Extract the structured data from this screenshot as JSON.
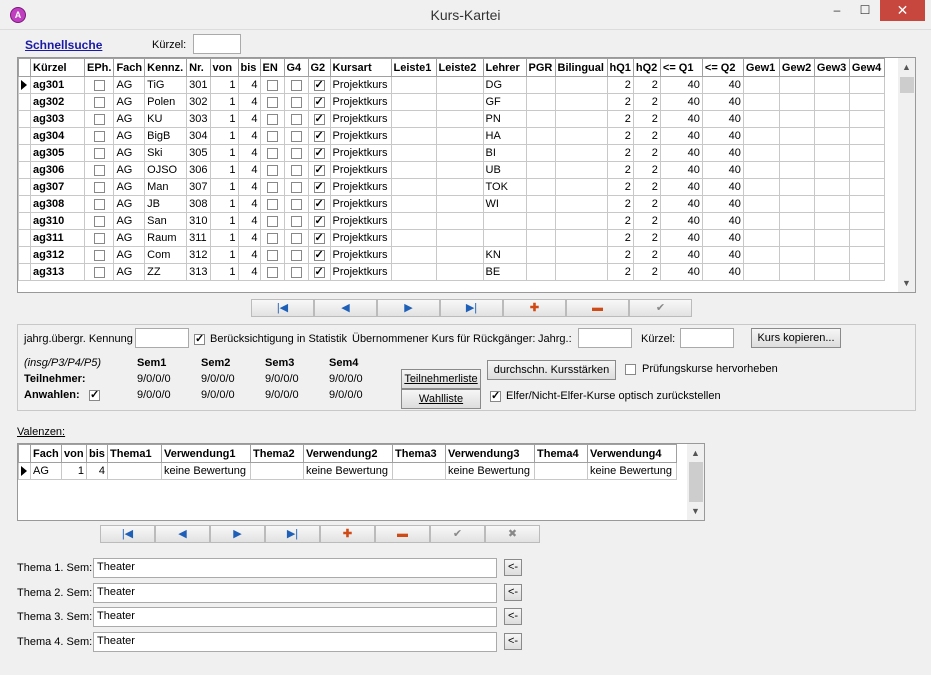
{
  "window": {
    "title": "Kurs-Kartei",
    "icon": "A",
    "min": "–",
    "max": "☐",
    "close": "✕"
  },
  "search": {
    "link": "Schnellsuche",
    "kuerzel_label": "Kürzel:",
    "kuerzel_value": ""
  },
  "main_grid": {
    "columns": [
      "Kürzel",
      "EPh.",
      "Fach",
      "Kennz.",
      "Nr.",
      "von",
      "bis",
      "EN",
      "G4",
      "G2",
      "Kursart",
      "Leiste1",
      "Leiste2",
      "Lehrer",
      "PGR",
      "Bilingual",
      "hQ1",
      "hQ2",
      "<= Q1",
      "<= Q2",
      "Gew1",
      "Gew2",
      "Gew3",
      "Gew4"
    ],
    "rows": [
      {
        "kuerzel": "ag301",
        "fach": "AG",
        "kennz": "TiG",
        "nr": "301",
        "von": "1",
        "bis": "4",
        "g2": true,
        "kursart": "Projektkurs",
        "lehrer": "DG",
        "hq1": "2",
        "hq2": "2",
        "q1": "40",
        "q2": "40"
      },
      {
        "kuerzel": "ag302",
        "fach": "AG",
        "kennz": "Polen",
        "nr": "302",
        "von": "1",
        "bis": "4",
        "g2": true,
        "kursart": "Projektkurs",
        "lehrer": "GF",
        "hq1": "2",
        "hq2": "2",
        "q1": "40",
        "q2": "40"
      },
      {
        "kuerzel": "ag303",
        "fach": "AG",
        "kennz": "KU",
        "nr": "303",
        "von": "1",
        "bis": "4",
        "g2": true,
        "kursart": "Projektkurs",
        "lehrer": "PN",
        "hq1": "2",
        "hq2": "2",
        "q1": "40",
        "q2": "40"
      },
      {
        "kuerzel": "ag304",
        "fach": "AG",
        "kennz": "BigB",
        "nr": "304",
        "von": "1",
        "bis": "4",
        "g2": true,
        "kursart": "Projektkurs",
        "lehrer": "HA",
        "hq1": "2",
        "hq2": "2",
        "q1": "40",
        "q2": "40"
      },
      {
        "kuerzel": "ag305",
        "fach": "AG",
        "kennz": "Ski",
        "nr": "305",
        "von": "1",
        "bis": "4",
        "g2": true,
        "kursart": "Projektkurs",
        "lehrer": "BI",
        "hq1": "2",
        "hq2": "2",
        "q1": "40",
        "q2": "40"
      },
      {
        "kuerzel": "ag306",
        "fach": "AG",
        "kennz": "OJSO",
        "nr": "306",
        "von": "1",
        "bis": "4",
        "g2": true,
        "kursart": "Projektkurs",
        "lehrer": "UB",
        "hq1": "2",
        "hq2": "2",
        "q1": "40",
        "q2": "40"
      },
      {
        "kuerzel": "ag307",
        "fach": "AG",
        "kennz": "Man",
        "nr": "307",
        "von": "1",
        "bis": "4",
        "g2": true,
        "kursart": "Projektkurs",
        "lehrer": "TOK",
        "hq1": "2",
        "hq2": "2",
        "q1": "40",
        "q2": "40"
      },
      {
        "kuerzel": "ag308",
        "fach": "AG",
        "kennz": "JB",
        "nr": "308",
        "von": "1",
        "bis": "4",
        "g2": true,
        "kursart": "Projektkurs",
        "lehrer": "WI",
        "hq1": "2",
        "hq2": "2",
        "q1": "40",
        "q2": "40"
      },
      {
        "kuerzel": "ag310",
        "fach": "AG",
        "kennz": "San",
        "nr": "310",
        "von": "1",
        "bis": "4",
        "g2": true,
        "kursart": "Projektkurs",
        "lehrer": "",
        "hq1": "2",
        "hq2": "2",
        "q1": "40",
        "q2": "40"
      },
      {
        "kuerzel": "ag311",
        "fach": "AG",
        "kennz": "Raum",
        "nr": "311",
        "von": "1",
        "bis": "4",
        "g2": true,
        "kursart": "Projektkurs",
        "lehrer": "",
        "hq1": "2",
        "hq2": "2",
        "q1": "40",
        "q2": "40"
      },
      {
        "kuerzel": "ag312",
        "fach": "AG",
        "kennz": "Com",
        "nr": "312",
        "von": "1",
        "bis": "4",
        "g2": true,
        "kursart": "Projektkurs",
        "lehrer": "KN",
        "hq1": "2",
        "hq2": "2",
        "q1": "40",
        "q2": "40"
      },
      {
        "kuerzel": "ag313",
        "fach": "AG",
        "kennz": "ZZ",
        "nr": "313",
        "von": "1",
        "bis": "4",
        "g2": true,
        "kursart": "Projektkurs",
        "lehrer": "BE",
        "hq1": "2",
        "hq2": "2",
        "q1": "40",
        "q2": "40"
      }
    ]
  },
  "nav_icons": {
    "first": "|◀",
    "prev": "◀",
    "next": "▶",
    "last": "▶|",
    "add": "✚",
    "delete": "▬",
    "confirm": "✔",
    "cancel": "✖"
  },
  "details": {
    "jahrg_label": "jahrg.übergr. Kennung",
    "statistik_label": "Berücksichtigung in Statistik",
    "statistik_checked": true,
    "uebernommen_label": "Übernommener Kurs für Rückgänger:",
    "jahrg2_label": "Jahrg.:",
    "kuerzel2_label": "Kürzel:",
    "kopieren_button": "Kurs kopieren...",
    "insg_label": "(insg/P3/P4/P5)",
    "sem_headers": [
      "Sem1",
      "Sem2",
      "Sem3",
      "Sem4"
    ],
    "teilnehmer_label": "Teilnehmer:",
    "teilnehmer_values": [
      "9/0/0/0",
      "9/0/0/0",
      "9/0/0/0",
      "9/0/0/0"
    ],
    "anwahlen_label": "Anwahlen:",
    "anwahlen_checked": true,
    "anwahlen_values": [
      "9/0/0/0",
      "9/0/0/0",
      "9/0/0/0",
      "9/0/0/0"
    ],
    "teilnehmerliste_button": "Teilnehmerliste",
    "wahlliste_button": "Wahlliste",
    "kursstaerken_button": "durchschn. Kursstärken",
    "pruefung_label": "Prüfungskurse hervorheben",
    "pruefung_checked": false,
    "elfer_label": "Elfer/Nicht-Elfer-Kurse optisch zurückstellen",
    "elfer_checked": true
  },
  "valenzen": {
    "label": "Valenzen:",
    "columns": [
      "Fach",
      "von",
      "bis",
      "Thema1",
      "Verwendung1",
      "Thema2",
      "Verwendung2",
      "Thema3",
      "Verwendung3",
      "Thema4",
      "Verwendung4"
    ],
    "rows": [
      {
        "fach": "AG",
        "von": "1",
        "bis": "4",
        "thema1": "",
        "verw1": "keine Bewertung",
        "thema2": "",
        "verw2": "keine Bewertung",
        "thema3": "",
        "verw3": "keine Bewertung",
        "thema4": "",
        "verw4": "keine Bewertung"
      }
    ]
  },
  "themen": [
    {
      "label": "Thema 1. Sem:",
      "value": "Theater",
      "button": "<-"
    },
    {
      "label": "Thema 2. Sem:",
      "value": "Theater",
      "button": "<-"
    },
    {
      "label": "Thema 3. Sem:",
      "value": "Theater",
      "button": "<-"
    },
    {
      "label": "Thema 4. Sem:",
      "value": "Theater",
      "button": "<-"
    }
  ]
}
